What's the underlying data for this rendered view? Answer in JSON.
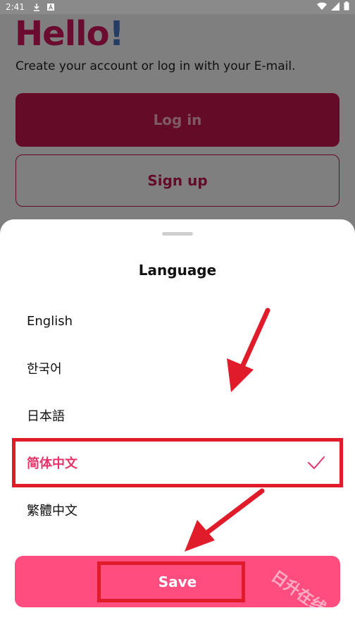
{
  "status_bar": {
    "time": "2:41",
    "icons": [
      "download-icon",
      "a-badge-icon",
      "wifi-icon",
      "signal-icon",
      "battery-icon"
    ]
  },
  "background": {
    "hello_text": "Hello",
    "hello_bang": "!",
    "subtitle": "Create your account or log in with your E-mail.",
    "login_label": "Log in",
    "signup_label": "Sign up"
  },
  "sheet": {
    "title": "Language",
    "items": [
      {
        "label": "English",
        "selected": false
      },
      {
        "label": "한국어",
        "selected": false
      },
      {
        "label": "日本語",
        "selected": false
      },
      {
        "label": "简体中文",
        "selected": true
      },
      {
        "label": "繁體中文",
        "selected": false
      }
    ],
    "save_label": "Save"
  },
  "watermark": "日升在线",
  "colors": {
    "accent": "#ff4d80",
    "brand": "#c8164f",
    "selected_text": "#e8336a",
    "annotation_red": "#e01b2a"
  }
}
